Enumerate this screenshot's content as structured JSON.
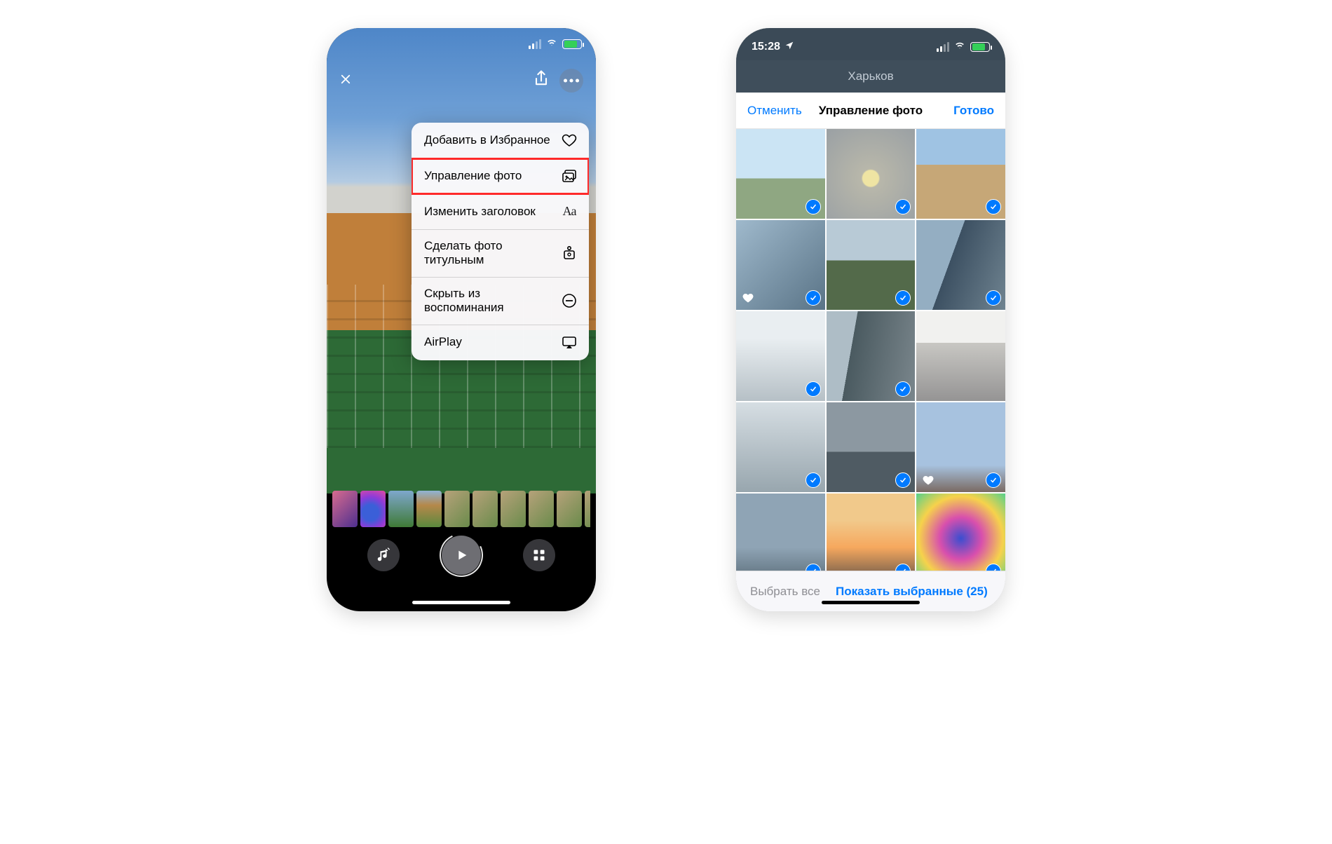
{
  "left": {
    "menu": {
      "favorite": "Добавить в Избранное",
      "manage": "Управление фото",
      "edit_title": "Изменить заголовок",
      "make_cover": "Сделать фото титульным",
      "hide": "Скрыть из воспоминания",
      "airplay": "AirPlay"
    }
  },
  "right": {
    "status_time": "15:28",
    "background_title": "Харьков",
    "sheet": {
      "cancel": "Отменить",
      "title": "Управление фото",
      "done": "Готово",
      "select_all": "Выбрать все",
      "show_selected": "Показать выбранные (25)",
      "selected_count": 25
    },
    "grid": [
      {
        "selected": true,
        "favorite": false
      },
      {
        "selected": true,
        "favorite": false
      },
      {
        "selected": true,
        "favorite": false
      },
      {
        "selected": true,
        "favorite": true
      },
      {
        "selected": true,
        "favorite": false
      },
      {
        "selected": true,
        "favorite": false
      },
      {
        "selected": true,
        "favorite": false
      },
      {
        "selected": true,
        "favorite": false
      },
      {
        "selected": false,
        "favorite": false
      },
      {
        "selected": true,
        "favorite": false
      },
      {
        "selected": true,
        "favorite": false
      },
      {
        "selected": true,
        "favorite": true
      },
      {
        "selected": true,
        "favorite": false
      },
      {
        "selected": true,
        "favorite": false
      },
      {
        "selected": true,
        "favorite": false
      }
    ]
  },
  "colors": {
    "ios_blue": "#007aff",
    "highlight_red": "#ff2a2a"
  }
}
